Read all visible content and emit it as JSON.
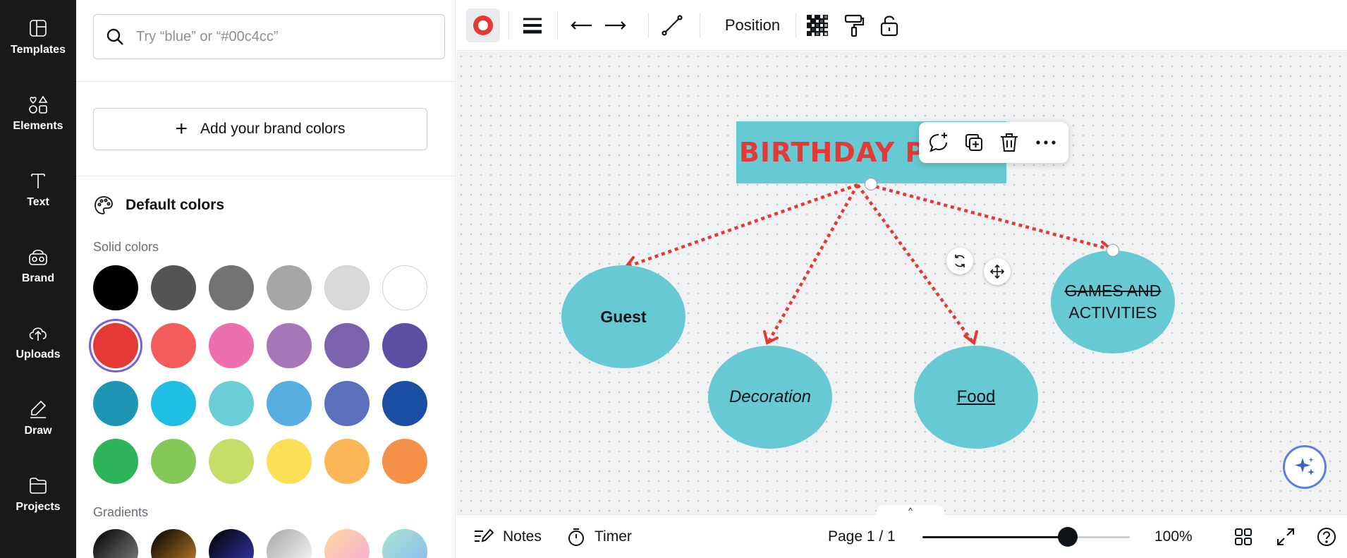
{
  "rail": {
    "items": [
      {
        "label": "Templates",
        "icon": "templates-icon"
      },
      {
        "label": "Elements",
        "icon": "elements-icon"
      },
      {
        "label": "Text",
        "icon": "text-icon"
      },
      {
        "label": "Brand",
        "icon": "brand-icon"
      },
      {
        "label": "Uploads",
        "icon": "uploads-icon"
      },
      {
        "label": "Draw",
        "icon": "draw-icon"
      },
      {
        "label": "Projects",
        "icon": "projects-icon"
      }
    ]
  },
  "panel": {
    "search_placeholder": "Try “blue” or “#00c4cc”",
    "add_brand_label": "Add your brand colors",
    "default_colors_label": "Default colors",
    "solid_label": "Solid colors",
    "gradients_label": "Gradients",
    "solid_colors": [
      [
        "#000000",
        "#545454",
        "#737373",
        "#a6a6a6",
        "#d9d9d9",
        "#ffffff"
      ],
      [
        "#e53935",
        "#f25c5c",
        "#ec6fae",
        "#a876b8",
        "#7a62ad",
        "#5a4fa3"
      ],
      [
        "#1d95b3",
        "#1fbde3",
        "#6ccdd6",
        "#58aee3",
        "#5b6fbd",
        "#1a4fa3"
      ],
      [
        "#2db35a",
        "#84c85a",
        "#c6dd6a",
        "#fcdf57",
        "#fcb657",
        "#f59049"
      ]
    ],
    "selected_color": "#e53935",
    "gradients": [
      [
        "#000000",
        "#8a8a8a"
      ],
      [
        "#000000",
        "#c8862a"
      ],
      [
        "#000000",
        "#3a3ab8"
      ],
      [
        "#a6a6a6",
        "#ffffff"
      ],
      [
        "#fcd9a0",
        "#f7a8d8"
      ],
      [
        "#a8e6cf",
        "#8ab6f0"
      ]
    ]
  },
  "toolbar": {
    "position_label": "Position"
  },
  "canvas": {
    "title": "BIRTHDAY PARTY",
    "nodes": {
      "guest": "Guest",
      "decoration": "Decoration",
      "food": "Food",
      "games_line1": "GAMES AND",
      "games_line2": "ACTIVITIES"
    },
    "accent_color": "#e53935",
    "shape_color": "#67c9d3"
  },
  "bottombar": {
    "notes_label": "Notes",
    "timer_label": "Timer",
    "page_label": "Page 1 / 1",
    "zoom_label": "100%",
    "zoom_fraction": 0.7
  }
}
